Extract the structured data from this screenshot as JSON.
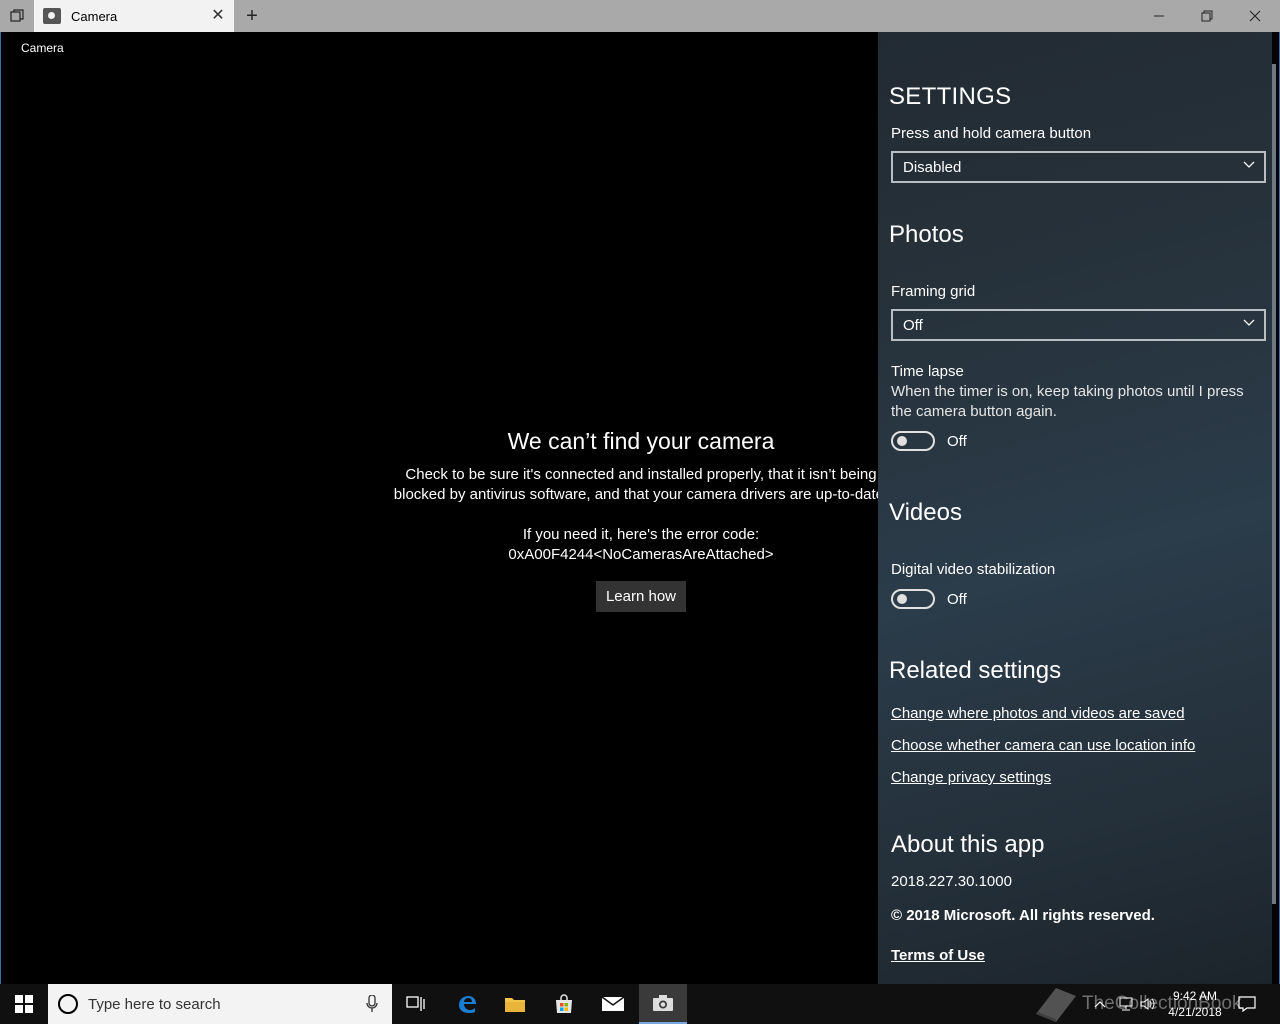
{
  "titlebar": {
    "tab_title": "Camera",
    "new_tab_symbol": "+",
    "close_symbol": "✕"
  },
  "app": {
    "title": "Camera",
    "error": {
      "heading": "We can’t find your camera",
      "line1": "Check to be sure it's connected and installed properly, that it isn’t being",
      "line2": "blocked by antivirus software, and that your camera drivers are up-to-date.",
      "code_label": "If you need it, here's the error code:",
      "code": "0xA00F4244<NoCamerasAreAttached>",
      "button": "Learn how"
    }
  },
  "settings": {
    "header": "SETTINGS",
    "camera_button_label": "Press and hold camera button",
    "camera_button_value": "Disabled",
    "photos_header": "Photos",
    "framing_grid_label": "Framing grid",
    "framing_grid_value": "Off",
    "time_lapse_label": "Time lapse",
    "time_lapse_desc": "When the timer is on, keep taking photos until I press the camera button again.",
    "time_lapse_state": "Off",
    "videos_header": "Videos",
    "stabilization_label": "Digital video stabilization",
    "stabilization_state": "Off",
    "related_header": "Related settings",
    "links": [
      "Change where photos and videos are saved",
      "Choose whether camera can use location info",
      "Change privacy settings"
    ],
    "about_header": "About this app",
    "version": "2018.227.30.1000",
    "copyright": "© 2018 Microsoft. All rights reserved.",
    "terms": "Terms of Use"
  },
  "taskbar": {
    "search_placeholder": "Type here to search",
    "time": "9:42 AM",
    "date": "4/21/2018",
    "watermark": "TheCollectionBook"
  }
}
